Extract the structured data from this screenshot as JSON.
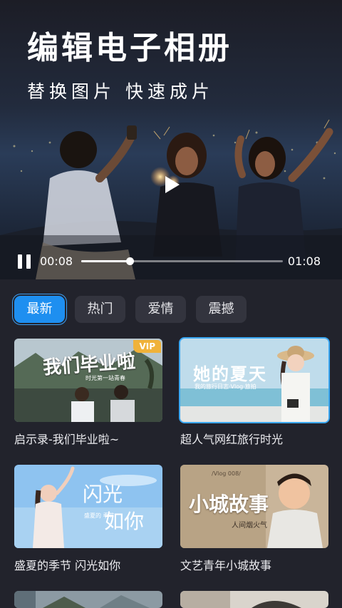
{
  "hero": {
    "title": "编辑电子相册",
    "subtitle": "替换图片 快速成片",
    "player": {
      "current_time": "00:08",
      "total_time": "01:08",
      "progress": 0.24,
      "state": "playing"
    }
  },
  "tabs": [
    {
      "label": "最新",
      "active": true
    },
    {
      "label": "热门",
      "active": false
    },
    {
      "label": "爱情",
      "active": false
    },
    {
      "label": "震撼",
      "active": false
    }
  ],
  "cards": [
    {
      "title": "启示录-我们毕业啦~",
      "thumb_title": "我们毕业啦",
      "thumb_sub": "时光第一站青春",
      "badge": "VIP",
      "selected": false
    },
    {
      "title": "超人气网红旅行时光",
      "thumb_title": "她的夏天",
      "thumb_sub": "我的旅行日志·Vlog·旅拍",
      "badge": "",
      "selected": true
    },
    {
      "title": "盛夏的季节 闪光如你",
      "thumb_title_1": "闪光",
      "thumb_title_2": "如你",
      "thumb_sub": "盛夏的 季节",
      "badge": "",
      "selected": false
    },
    {
      "title": "文艺青年小城故事",
      "thumb_title": "小城故事",
      "thumb_sub": "人间烟火气",
      "thumb_tag": "/Vlog 008/",
      "badge": "",
      "selected": false
    }
  ],
  "colors": {
    "accent": "#1e8ff0",
    "background": "#22232c",
    "tab_inactive": "#33343e",
    "vip": "#f0b23a",
    "selected_border": "#3aa7f2"
  },
  "icons": {
    "pause": "pause-icon",
    "play": "play-icon"
  }
}
